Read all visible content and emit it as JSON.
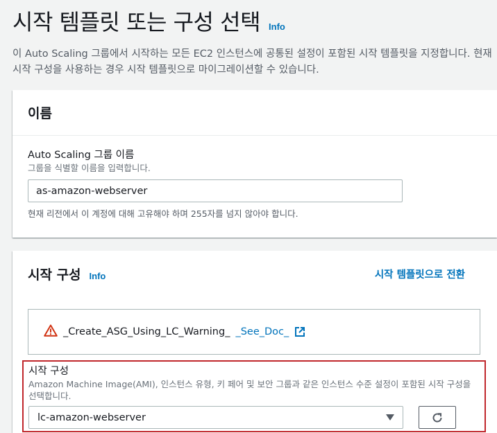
{
  "page": {
    "title": "시작 템플릿 또는 구성 선택",
    "info_label": "Info",
    "description": "이 Auto Scaling 그룹에서 시작하는 모든 EC2 인스턴스에 공통된 설정이 포함된 시작 템플릿을 지정합니다. 현재 시작 구성을 사용하는 경우 시작 템플릿으로 마이그레이션할 수 있습니다."
  },
  "name_panel": {
    "title": "이름",
    "field_label": "Auto Scaling 그룹 이름",
    "field_hint": "그룹을 식별할 이름을 입력합니다.",
    "input_value": "as-amazon-webserver",
    "constraint": "현재 리전에서 이 계정에 대해 고유해야 하며 255자를 넘지 않아야 합니다."
  },
  "launch_panel": {
    "title": "시작 구성",
    "info_label": "Info",
    "switch_link": "시작 템플릿으로 전환",
    "alert_text": "_Create_ASG_Using_LC_Warning_",
    "alert_link": "_See_Doc_",
    "field_label": "시작 구성",
    "field_hint": "Amazon Machine Image(AMI), 인스턴스 유형, 키 페어 및 보안 그룹과 같은 인스턴스 수준 설정이 포함된 시작 구성을 선택합니다.",
    "select_value": "lc-amazon-webserver"
  },
  "icons": {
    "warning": "warning-icon",
    "external": "external-link-icon",
    "refresh": "refresh-icon",
    "dropdown": "caret-down-icon"
  },
  "colors": {
    "link": "#0073bb",
    "warning": "#d13212",
    "highlight_border": "#c0262b"
  }
}
